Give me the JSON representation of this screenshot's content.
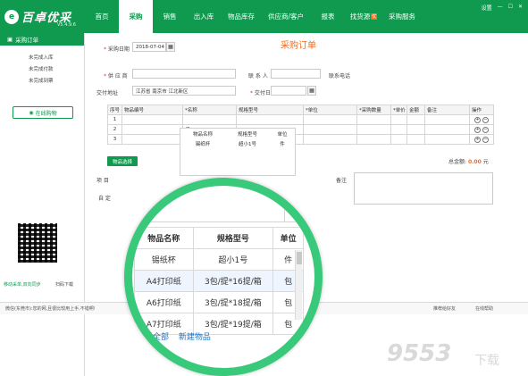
{
  "app": {
    "brand": "百卓优采",
    "version": "V5.4.9.6",
    "logo_letter": "e"
  },
  "nav": [
    {
      "label": "首页",
      "active": false
    },
    {
      "label": "采购",
      "active": true
    },
    {
      "label": "销售",
      "active": false
    },
    {
      "label": "出入库",
      "active": false
    },
    {
      "label": "物品库存",
      "active": false
    },
    {
      "label": "供应商/客户",
      "active": false
    },
    {
      "label": "报表",
      "active": false
    },
    {
      "label": "找货源",
      "active": false
    },
    {
      "label": "采购服务",
      "active": false
    }
  ],
  "nav_badge": "优",
  "top_right": {
    "settings": "设置",
    "minimize": "—",
    "maximize": "☐",
    "close": "✕"
  },
  "sidebar": {
    "header": "采购订单",
    "items": [
      "未完成入库",
      "未完成付款",
      "未完成到票"
    ],
    "online_button": "在线购物",
    "qr_caption_left": "移动采单,双向同步",
    "qr_caption_right": "扫码下载"
  },
  "form": {
    "title": "采购订单",
    "purchase_date_label": "采购日期",
    "purchase_date": "2018-07-04",
    "supplier_label": "供 应 商",
    "contact_label": "联 系 人",
    "phone_label": "联系电话",
    "delivery_label": "交付地址",
    "delivery_address": "江苏省 南京市 江北新区",
    "delivery_date_label": "交付日期",
    "project_label": "项 目",
    "custom_label": "自 定",
    "memo_label": "备注",
    "total_label": "总金额:",
    "total_value": "0.00",
    "total_unit": "元",
    "select_goods_button": "物品选择"
  },
  "grid": {
    "columns": [
      "序号",
      "物品编号",
      "*名称",
      "规格型号",
      "*单位",
      "*采购数量",
      "*单价",
      "金额",
      "备注",
      "操作"
    ],
    "rows": [
      {
        "no": "1",
        "name": ""
      },
      {
        "no": "2",
        "name": "纸"
      },
      {
        "no": "3",
        "name": ""
      }
    ]
  },
  "mini_popup": {
    "headers": [
      "物品名称",
      "规格型号",
      "单位"
    ],
    "first_row": [
      "锡纸杯",
      "超小1号",
      "件"
    ]
  },
  "magnifier": {
    "query": "纸",
    "more_button": "···",
    "headers": [
      "物品名称",
      "规格型号",
      "单位"
    ],
    "rows": [
      {
        "name": "锡纸杯",
        "spec": "超小1号",
        "unit": "件"
      },
      {
        "name": "A4打印纸",
        "spec": "3包/提*16提/箱",
        "unit": "包"
      },
      {
        "name": "A6打印纸",
        "spec": "3包/提*18提/箱",
        "unit": "包"
      },
      {
        "name": "A7打印纸",
        "spec": "3包/提*19提/箱",
        "unit": "包"
      }
    ],
    "view_all": "查看全部",
    "new_item": "新建物品"
  },
  "status": {
    "left": "微信(东莞市):您的网,且很比较用上手,不错啊!",
    "recommend": "推荐给好友",
    "help": "在线帮助"
  },
  "watermark": {
    "text": "9553",
    "sub": "下载"
  },
  "colors": {
    "brand_green": "#0f9a4f",
    "accent_orange": "#f56a1e",
    "magnifier_ring": "#38c97a"
  }
}
